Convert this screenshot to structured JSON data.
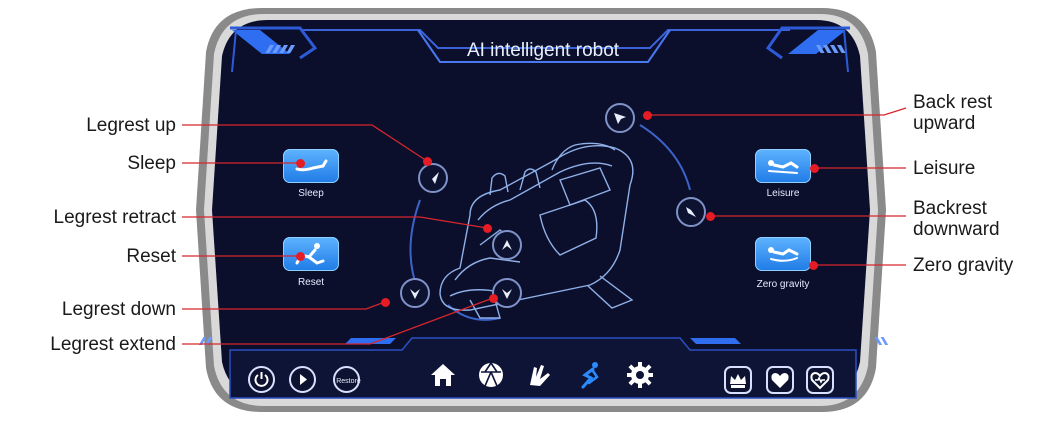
{
  "screen": {
    "title": "AI intelligent robot"
  },
  "modes": {
    "sleep": {
      "label": "Sleep",
      "icon": "sleep-icon"
    },
    "reset": {
      "label": "Reset",
      "icon": "reset-icon"
    },
    "leisure": {
      "label": "Leisure",
      "icon": "leisure-icon"
    },
    "zero_gravity": {
      "label": "Zero gravity",
      "icon": "zero-gravity-icon"
    }
  },
  "callouts": {
    "legrest_up": "Legrest up",
    "sleep": "Sleep",
    "legrest_retract": "Legrest retract",
    "reset": "Reset",
    "legrest_down": "Legrest down",
    "legrest_extend": "Legrest extend",
    "back_rest_upward": "Back rest\nupward",
    "leisure": "Leisure",
    "backrest_downward": "Backrest\ndownward",
    "zero_gravity": "Zero gravity"
  },
  "bottom_bar": {
    "power_icon": "power-icon",
    "play_icon": "play-icon",
    "restore_label": "Restore",
    "nav_icons": [
      "home-icon",
      "ball-icon",
      "hands-icon",
      "body-icon",
      "gear-icon"
    ],
    "badge_icons": [
      "vip-crown-icon",
      "heart-icon",
      "health-heart-icon"
    ]
  },
  "colors": {
    "frame": "#7a7a7a",
    "screen_bg": "#0b0f2c",
    "accent_blue": "#2f6ef0",
    "button_blue": "#2b8af0",
    "callout_line": "#d7262c",
    "callout_dot": "#e51c23"
  }
}
